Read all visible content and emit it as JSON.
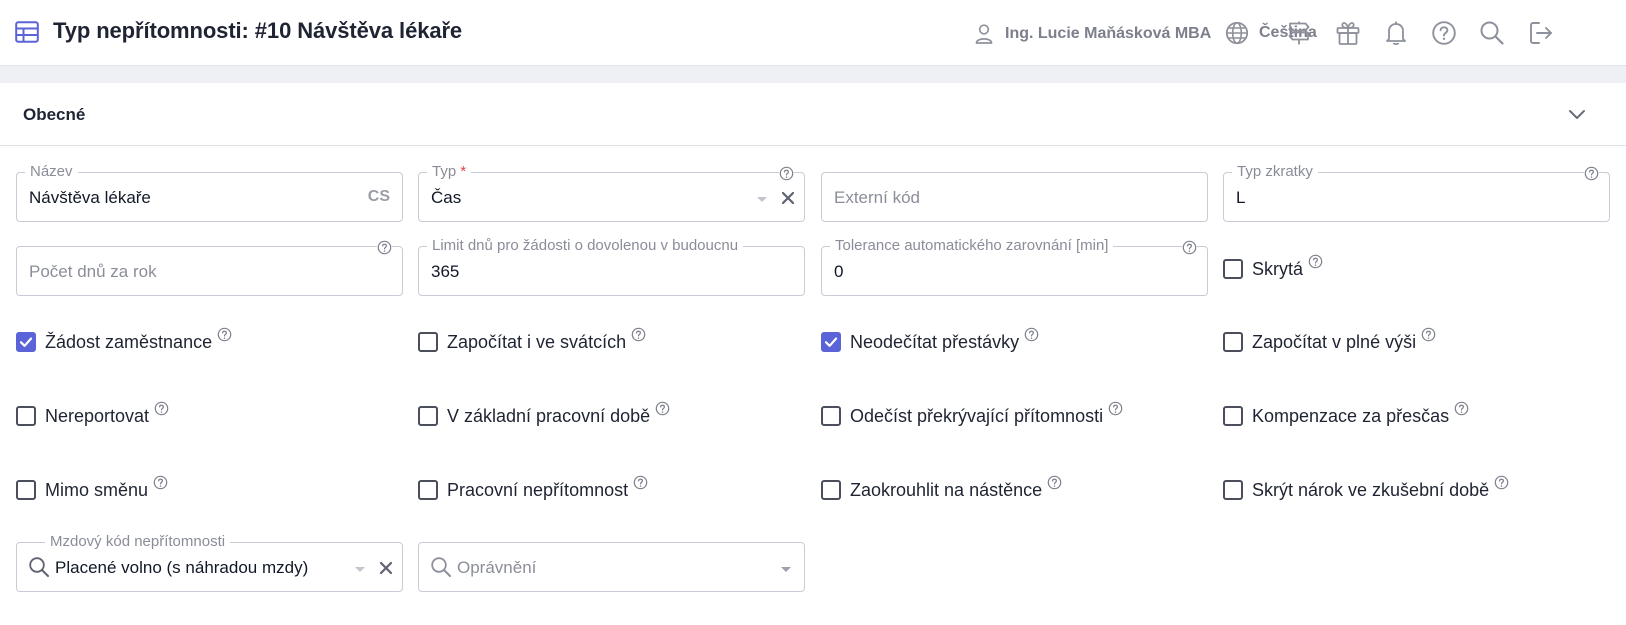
{
  "header": {
    "title": "Typ nepřítomnosti: #10 Návštěva lékaře",
    "user_name": "Ing. Lucie Maňásková MBA",
    "language": "Čeština",
    "icons": [
      "table-icon",
      "user-icon",
      "globe-icon",
      "signpost-icon",
      "gift-icon",
      "bell-icon",
      "help-circle-icon",
      "search-icon",
      "logout-icon"
    ]
  },
  "section": {
    "title": "Obecné"
  },
  "fields": {
    "nazev": {
      "label": "Název",
      "value": "Návštěva lékaře",
      "suffix": "CS"
    },
    "typ": {
      "label": "Typ",
      "required_mark": "*",
      "value": "Čas"
    },
    "externi_kod": {
      "placeholder": "Externí kód",
      "value": ""
    },
    "typ_zkratky": {
      "label": "Typ zkratky",
      "value": "L"
    },
    "pocet_dnu": {
      "placeholder": "Počet dnů za rok",
      "value": ""
    },
    "limit_dnu": {
      "label": "Limit dnů pro žádosti o dovolenou v budoucnu",
      "value": "365"
    },
    "tolerance": {
      "label": "Tolerance automatického zarovnání [min]",
      "value": "0"
    },
    "mzdovy_kod": {
      "label": "Mzdový kód nepřítomnosti",
      "value": "Placené volno (s náhradou mzdy)"
    },
    "opravneni": {
      "placeholder": "Oprávnění",
      "value": ""
    }
  },
  "checkboxes": {
    "skryta": {
      "label": "Skrytá",
      "checked": false
    },
    "zadost": {
      "label": "Žádost zaměstnance",
      "checked": true
    },
    "svatky": {
      "label": "Započítat i ve svátcích",
      "checked": false
    },
    "prestavky": {
      "label": "Neodečítat přestávky",
      "checked": true
    },
    "plna_vyse": {
      "label": "Započítat v plné výši",
      "checked": false
    },
    "nereportovat": {
      "label": "Nereportovat",
      "checked": false
    },
    "zakladni_doba": {
      "label": "V základní pracovní době",
      "checked": false
    },
    "odecist": {
      "label": "Odečíst překrývající přítomnosti",
      "checked": false
    },
    "kompenzace": {
      "label": "Kompenzace za přesčas",
      "checked": false
    },
    "mimo_smenu": {
      "label": "Mimo směnu",
      "checked": false
    },
    "pracovni_nepritomnost": {
      "label": "Pracovní nepřítomnost",
      "checked": false
    },
    "zaokrouhlit": {
      "label": "Zaokrouhlit na nástěnce",
      "checked": false
    },
    "skryt_narok": {
      "label": "Skrýt nárok ve zkušební době",
      "checked": false
    }
  },
  "colors": {
    "accent": "#5b63d8",
    "required": "#e0454b",
    "border": "#c9ccd6",
    "muted_text": "#8a8d99"
  }
}
